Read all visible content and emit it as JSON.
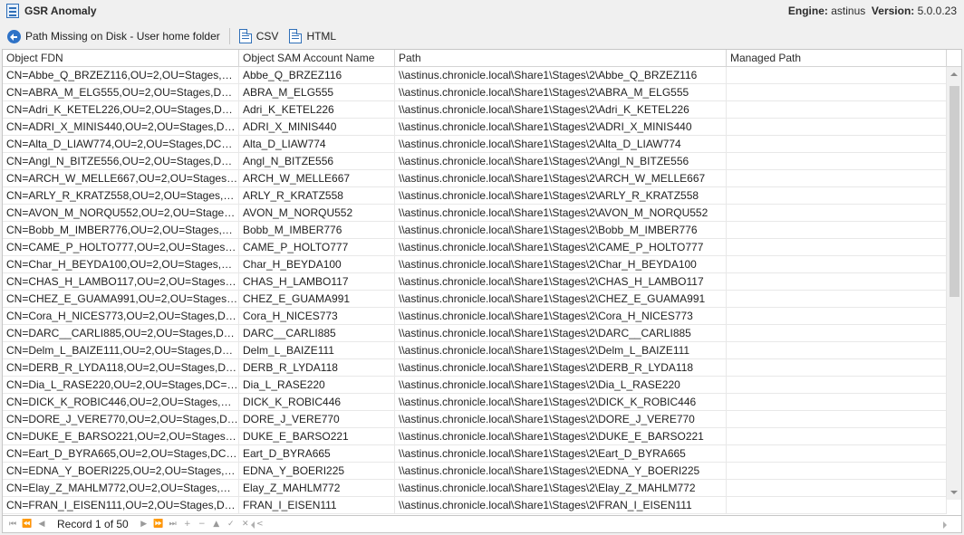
{
  "window": {
    "title": "GSR Anomaly",
    "engine_label": "Engine:",
    "engine_value": "astinus",
    "version_label": "Version:",
    "version_value": "5.0.0.23"
  },
  "toolbar": {
    "back_label": "Path Missing on Disk - User home folder",
    "csv_label": "CSV",
    "html_label": "HTML"
  },
  "table": {
    "columns": [
      "Object FDN",
      "Object SAM Account Name",
      "Path",
      "Managed Path"
    ],
    "rows": [
      [
        "CN=Abbe_Q_BRZEZ116,OU=2,OU=Stages,DC=ch...",
        "Abbe_Q_BRZEZ116",
        "\\\\astinus.chronicle.local\\Share1\\Stages\\2\\Abbe_Q_BRZEZ116",
        ""
      ],
      [
        "CN=ABRA_M_ELG555,OU=2,OU=Stages,DC=ch...",
        "ABRA_M_ELG555",
        "\\\\astinus.chronicle.local\\Share1\\Stages\\2\\ABRA_M_ELG555",
        ""
      ],
      [
        "CN=Adri_K_KETEL226,OU=2,OU=Stages,DC=ch...",
        "Adri_K_KETEL226",
        "\\\\astinus.chronicle.local\\Share1\\Stages\\2\\Adri_K_KETEL226",
        ""
      ],
      [
        "CN=ADRI_X_MINIS440,OU=2,OU=Stages,DC=c...",
        "ADRI_X_MINIS440",
        "\\\\astinus.chronicle.local\\Share1\\Stages\\2\\ADRI_X_MINIS440",
        ""
      ],
      [
        "CN=Alta_D_LIAW774,OU=2,OU=Stages,DC=chr...",
        "Alta_D_LIAW774",
        "\\\\astinus.chronicle.local\\Share1\\Stages\\2\\Alta_D_LIAW774",
        ""
      ],
      [
        "CN=Angl_N_BITZE556,OU=2,OU=Stages,DC=ch...",
        "Angl_N_BITZE556",
        "\\\\astinus.chronicle.local\\Share1\\Stages\\2\\Angl_N_BITZE556",
        ""
      ],
      [
        "CN=ARCH_W_MELLE667,OU=2,OU=Stages,DC...",
        "ARCH_W_MELLE667",
        "\\\\astinus.chronicle.local\\Share1\\Stages\\2\\ARCH_W_MELLE667",
        ""
      ],
      [
        "CN=ARLY_R_KRATZ558,OU=2,OU=Stages,DC=c...",
        "ARLY_R_KRATZ558",
        "\\\\astinus.chronicle.local\\Share1\\Stages\\2\\ARLY_R_KRATZ558",
        ""
      ],
      [
        "CN=AVON_M_NORQU552,OU=2,OU=Stages,DC...",
        "AVON_M_NORQU552",
        "\\\\astinus.chronicle.local\\Share1\\Stages\\2\\AVON_M_NORQU552",
        ""
      ],
      [
        "CN=Bobb_M_IMBER776,OU=2,OU=Stages,DC=...",
        "Bobb_M_IMBER776",
        "\\\\astinus.chronicle.local\\Share1\\Stages\\2\\Bobb_M_IMBER776",
        ""
      ],
      [
        "CN=CAME_P_HOLTO777,OU=2,OU=Stages,DC=...",
        "CAME_P_HOLTO777",
        "\\\\astinus.chronicle.local\\Share1\\Stages\\2\\CAME_P_HOLTO777",
        ""
      ],
      [
        "CN=Char_H_BEYDA100,OU=2,OU=Stages,DC=c...",
        "Char_H_BEYDA100",
        "\\\\astinus.chronicle.local\\Share1\\Stages\\2\\Char_H_BEYDA100",
        ""
      ],
      [
        "CN=CHAS_H_LAMBO117,OU=2,OU=Stages,DC...",
        "CHAS_H_LAMBO117",
        "\\\\astinus.chronicle.local\\Share1\\Stages\\2\\CHAS_H_LAMBO117",
        ""
      ],
      [
        "CN=CHEZ_E_GUAMA991,OU=2,OU=Stages,DC...",
        "CHEZ_E_GUAMA991",
        "\\\\astinus.chronicle.local\\Share1\\Stages\\2\\CHEZ_E_GUAMA991",
        ""
      ],
      [
        "CN=Cora_H_NICES773,OU=2,OU=Stages,DC=c...",
        "Cora_H_NICES773",
        "\\\\astinus.chronicle.local\\Share1\\Stages\\2\\Cora_H_NICES773",
        ""
      ],
      [
        "CN=DARC__CARLI885,OU=2,OU=Stages,DC=c...",
        "DARC__CARLI885",
        "\\\\astinus.chronicle.local\\Share1\\Stages\\2\\DARC__CARLI885",
        ""
      ],
      [
        "CN=Delm_L_BAIZE111,OU=2,OU=Stages,DC=c...",
        "Delm_L_BAIZE111",
        "\\\\astinus.chronicle.local\\Share1\\Stages\\2\\Delm_L_BAIZE111",
        ""
      ],
      [
        "CN=DERB_R_LYDA118,OU=2,OU=Stages,DC=c...",
        "DERB_R_LYDA118",
        "\\\\astinus.chronicle.local\\Share1\\Stages\\2\\DERB_R_LYDA118",
        ""
      ],
      [
        "CN=Dia_L_RASE220,OU=2,OU=Stages,DC=chro...",
        "Dia_L_RASE220",
        "\\\\astinus.chronicle.local\\Share1\\Stages\\2\\Dia_L_RASE220",
        ""
      ],
      [
        "CN=DICK_K_ROBIC446,OU=2,OU=Stages,DC=c...",
        "DICK_K_ROBIC446",
        "\\\\astinus.chronicle.local\\Share1\\Stages\\2\\DICK_K_ROBIC446",
        ""
      ],
      [
        "CN=DORE_J_VERE770,OU=2,OU=Stages,DC=c...",
        "DORE_J_VERE770",
        "\\\\astinus.chronicle.local\\Share1\\Stages\\2\\DORE_J_VERE770",
        ""
      ],
      [
        "CN=DUKE_E_BARSO221,OU=2,OU=Stages,DC=...",
        "DUKE_E_BARSO221",
        "\\\\astinus.chronicle.local\\Share1\\Stages\\2\\DUKE_E_BARSO221",
        ""
      ],
      [
        "CN=Eart_D_BYRA665,OU=2,OU=Stages,DC=ch...",
        "Eart_D_BYRA665",
        "\\\\astinus.chronicle.local\\Share1\\Stages\\2\\Eart_D_BYRA665",
        ""
      ],
      [
        "CN=EDNA_Y_BOERI225,OU=2,OU=Stages,DC=c...",
        "EDNA_Y_BOERI225",
        "\\\\astinus.chronicle.local\\Share1\\Stages\\2\\EDNA_Y_BOERI225",
        ""
      ],
      [
        "CN=Elay_Z_MAHLM772,OU=2,OU=Stages,DC=c...",
        "Elay_Z_MAHLM772",
        "\\\\astinus.chronicle.local\\Share1\\Stages\\2\\Elay_Z_MAHLM772",
        ""
      ],
      [
        "CN=FRAN_I_EISEN111,OU=2,OU=Stages,DC=c...",
        "FRAN_I_EISEN111",
        "\\\\astinus.chronicle.local\\Share1\\Stages\\2\\FRAN_I_EISEN111",
        ""
      ]
    ]
  },
  "navigator": {
    "record_text": "Record 1 of 50",
    "buttons": [
      "⏮",
      "⏪",
      "◀",
      "▶",
      "⏩",
      "⏭",
      "+",
      "−",
      "▲",
      "✓",
      "✕",
      "<"
    ]
  },
  "icons": {
    "app": "app-icon",
    "back": "back-arrow-icon",
    "csv": "csv-file-icon",
    "html": "html-file-icon"
  }
}
